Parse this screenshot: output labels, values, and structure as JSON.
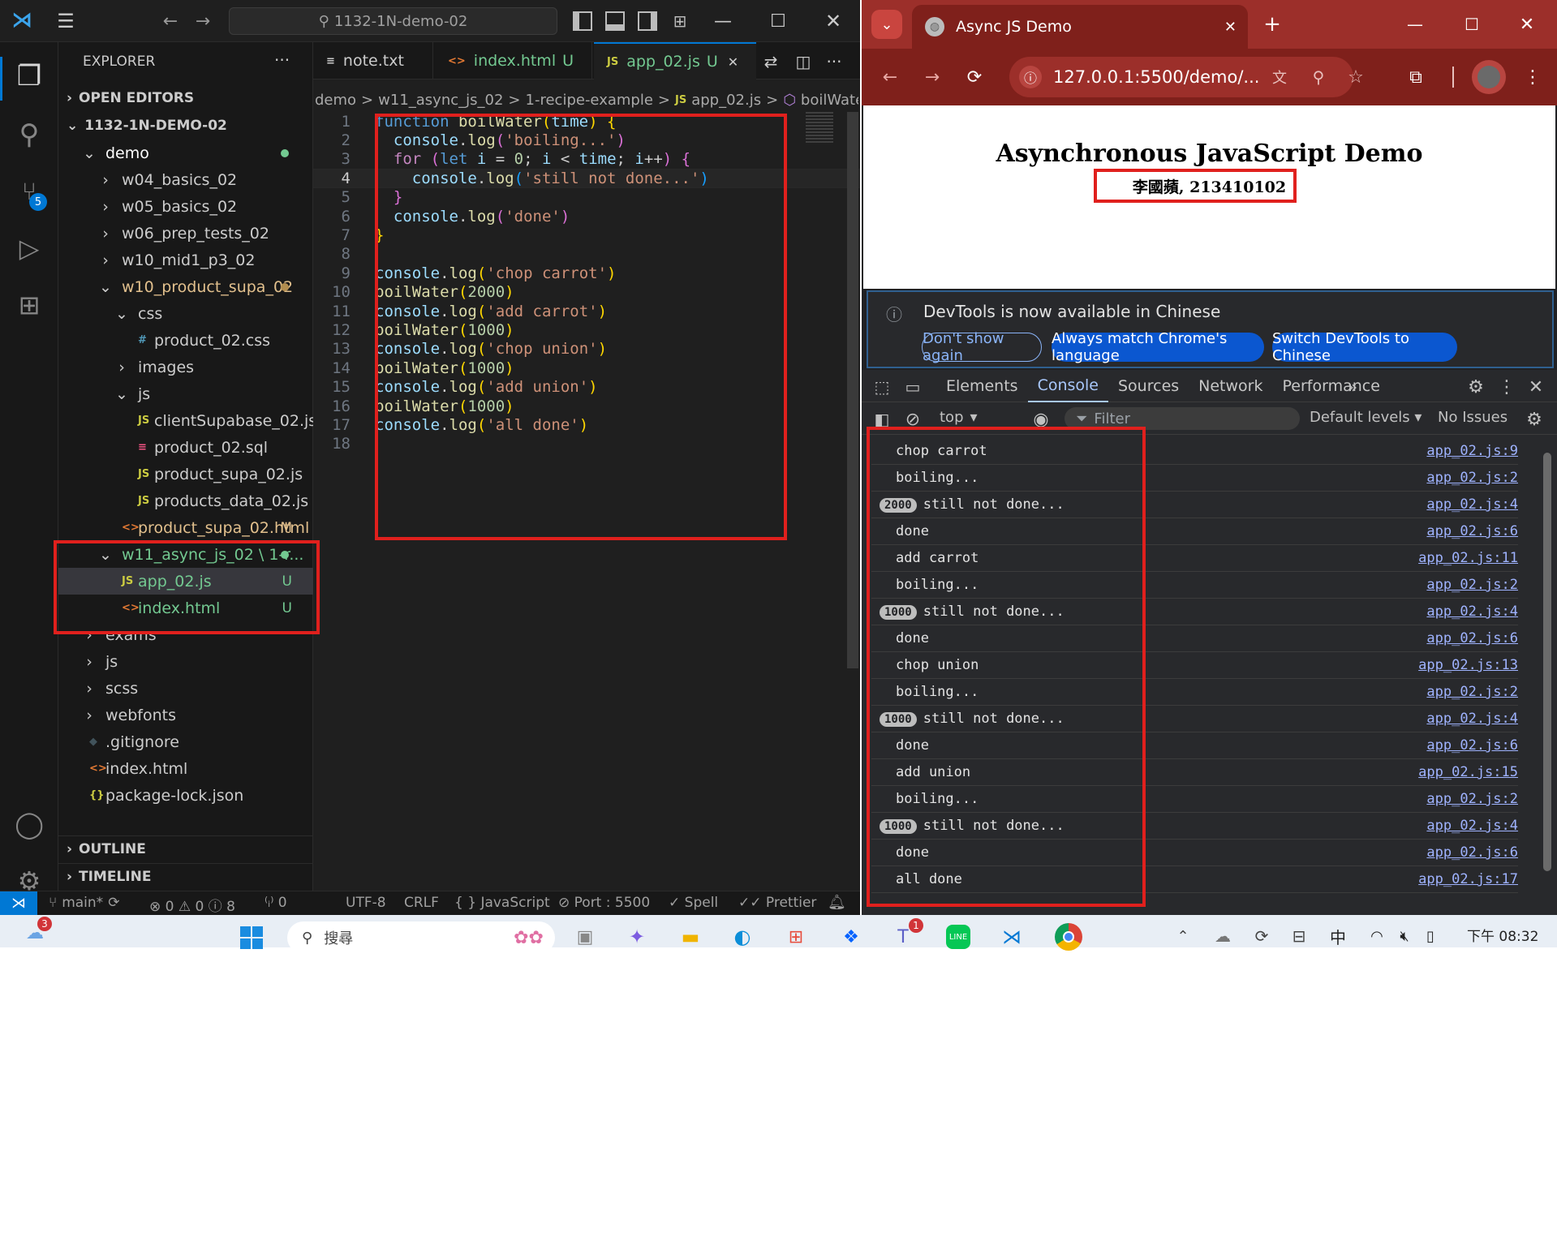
{
  "vscode": {
    "search_text": "1132-1N-demo-02",
    "explorer_title": "EXPLORER",
    "open_editors": "OPEN EDITORS",
    "project": "1132-1N-DEMO-02",
    "tree": [
      {
        "label": "demo",
        "indent": 0,
        "chev": "v",
        "color": "#ffffff",
        "dot": "#73c991"
      },
      {
        "label": "w04_basics_02",
        "indent": 1,
        "chev": ">",
        "color": "#cccccc"
      },
      {
        "label": "w05_basics_02",
        "indent": 1,
        "chev": ">",
        "color": "#cccccc"
      },
      {
        "label": "w06_prep_tests_02",
        "indent": 1,
        "chev": ">",
        "color": "#cccccc"
      },
      {
        "label": "w10_mid1_p3_02",
        "indent": 1,
        "chev": ">",
        "color": "#cccccc"
      },
      {
        "label": "w10_product_supa_02",
        "indent": 1,
        "chev": "v",
        "color": "#e2c08d",
        "dot": "#b28d4f"
      },
      {
        "label": "css",
        "indent": 2,
        "chev": "v",
        "color": "#cccccc"
      },
      {
        "label": "product_02.css",
        "indent": 3,
        "icon": "#",
        "iconcolor": "#519aba",
        "color": "#cccccc"
      },
      {
        "label": "images",
        "indent": 2,
        "chev": ">",
        "color": "#cccccc"
      },
      {
        "label": "js",
        "indent": 2,
        "chev": "v",
        "color": "#cccccc"
      },
      {
        "label": "clientSupabase_02.js",
        "indent": 3,
        "icon": "JS",
        "iconcolor": "#cbcb41",
        "color": "#cccccc"
      },
      {
        "label": "product_02.sql",
        "indent": 3,
        "icon": "≡",
        "iconcolor": "#f55385",
        "color": "#cccccc"
      },
      {
        "label": "product_supa_02.js",
        "indent": 3,
        "icon": "JS",
        "iconcolor": "#cbcb41",
        "color": "#cccccc"
      },
      {
        "label": "products_data_02.js",
        "indent": 3,
        "icon": "JS",
        "iconcolor": "#cbcb41",
        "color": "#cccccc"
      },
      {
        "label": "product_supa_02.html",
        "indent": 2,
        "icon": "<>",
        "iconcolor": "#e37933",
        "color": "#e2c08d",
        "badge": "M"
      },
      {
        "label": "w11_async_js_02 \\ 1-r...",
        "indent": 1,
        "chev": "v",
        "color": "#73c991",
        "dot": "#73c991"
      },
      {
        "label": "app_02.js",
        "indent": 2,
        "icon": "JS",
        "iconcolor": "#cbcb41",
        "color": "#73c991",
        "badge": "U",
        "selected": true
      },
      {
        "label": "index.html",
        "indent": 2,
        "icon": "<>",
        "iconcolor": "#e37933",
        "color": "#73c991",
        "badge": "U"
      },
      {
        "label": "exams",
        "indent": 0,
        "chev": ">",
        "color": "#cccccc"
      },
      {
        "label": "js",
        "indent": 0,
        "chev": ">",
        "color": "#cccccc"
      },
      {
        "label": "scss",
        "indent": 0,
        "chev": ">",
        "color": "#cccccc"
      },
      {
        "label": "webfonts",
        "indent": 0,
        "chev": ">",
        "color": "#cccccc"
      },
      {
        "label": ".gitignore",
        "indent": 0,
        "icon": "◆",
        "iconcolor": "#41535b",
        "color": "#cccccc"
      },
      {
        "label": "index.html",
        "indent": 0,
        "icon": "<>",
        "iconcolor": "#e37933",
        "color": "#cccccc"
      },
      {
        "label": "package-lock.json",
        "indent": 0,
        "icon": "{}",
        "iconcolor": "#cbcb41",
        "color": "#cccccc"
      }
    ],
    "outline": "OUTLINE",
    "timeline": "TIMELINE",
    "tabs": [
      {
        "label": "note.txt",
        "icon": "≡",
        "iconcolor": "#cccccc",
        "color": "#cccccc"
      },
      {
        "label": "index.html",
        "suffix": "U",
        "icon": "<>",
        "iconcolor": "#e37933",
        "color": "#73c991"
      },
      {
        "label": "app_02.js",
        "suffix": "U",
        "icon": "JS",
        "iconcolor": "#cbcb41",
        "color": "#73c991",
        "active": true
      }
    ],
    "breadcrumb": [
      "demo",
      ">",
      "w11_async_js_02",
      ">",
      "1-recipe-example",
      ">",
      "JS",
      "app_02.js",
      ">",
      "⬡",
      "boilWater"
    ],
    "code": [
      [
        [
          "function ",
          "kw"
        ],
        [
          "boilWater",
          "fn"
        ],
        [
          "(",
          "br1"
        ],
        [
          "time",
          "var"
        ],
        [
          ")",
          "br1"
        ],
        [
          " {",
          "br1"
        ]
      ],
      [
        [
          "  console",
          "var"
        ],
        [
          ".",
          "pl"
        ],
        [
          "log",
          "fn"
        ],
        [
          "(",
          "br2"
        ],
        [
          "'boiling...'",
          "str"
        ],
        [
          ")",
          "br2"
        ]
      ],
      [
        [
          "  for ",
          "ctl"
        ],
        [
          "(",
          "br2"
        ],
        [
          "let ",
          "kw"
        ],
        [
          "i",
          "var"
        ],
        [
          " = ",
          "pl"
        ],
        [
          "0",
          "num"
        ],
        [
          "; ",
          "pl"
        ],
        [
          "i",
          "var"
        ],
        [
          " < ",
          "pl"
        ],
        [
          "time",
          "var"
        ],
        [
          "; ",
          "pl"
        ],
        [
          "i",
          "var"
        ],
        [
          "++",
          "pl"
        ],
        [
          ")",
          "br2"
        ],
        [
          " {",
          "br2"
        ]
      ],
      [
        [
          "    console",
          "var"
        ],
        [
          ".",
          "pl"
        ],
        [
          "log",
          "fn"
        ],
        [
          "(",
          "br3"
        ],
        [
          "'still not done...'",
          "str"
        ],
        [
          ")",
          "br3"
        ]
      ],
      [
        [
          "  }",
          "br2"
        ]
      ],
      [
        [
          "  console",
          "var"
        ],
        [
          ".",
          "pl"
        ],
        [
          "log",
          "fn"
        ],
        [
          "(",
          "br2"
        ],
        [
          "'done'",
          "str"
        ],
        [
          ")",
          "br2"
        ]
      ],
      [
        [
          "}",
          "br1"
        ]
      ],
      [],
      [
        [
          "console",
          "var"
        ],
        [
          ".",
          "pl"
        ],
        [
          "log",
          "fn"
        ],
        [
          "(",
          "br1"
        ],
        [
          "'chop carrot'",
          "str"
        ],
        [
          ")",
          "br1"
        ]
      ],
      [
        [
          "boilWater",
          "fn"
        ],
        [
          "(",
          "br1"
        ],
        [
          "2000",
          "num"
        ],
        [
          ")",
          "br1"
        ]
      ],
      [
        [
          "console",
          "var"
        ],
        [
          ".",
          "pl"
        ],
        [
          "log",
          "fn"
        ],
        [
          "(",
          "br1"
        ],
        [
          "'add carrot'",
          "str"
        ],
        [
          ")",
          "br1"
        ]
      ],
      [
        [
          "boilWater",
          "fn"
        ],
        [
          "(",
          "br1"
        ],
        [
          "1000",
          "num"
        ],
        [
          ")",
          "br1"
        ]
      ],
      [
        [
          "console",
          "var"
        ],
        [
          ".",
          "pl"
        ],
        [
          "log",
          "fn"
        ],
        [
          "(",
          "br1"
        ],
        [
          "'chop union'",
          "str"
        ],
        [
          ")",
          "br1"
        ]
      ],
      [
        [
          "boilWater",
          "fn"
        ],
        [
          "(",
          "br1"
        ],
        [
          "1000",
          "num"
        ],
        [
          ")",
          "br1"
        ]
      ],
      [
        [
          "console",
          "var"
        ],
        [
          ".",
          "pl"
        ],
        [
          "log",
          "fn"
        ],
        [
          "(",
          "br1"
        ],
        [
          "'add union'",
          "str"
        ],
        [
          ")",
          "br1"
        ]
      ],
      [
        [
          "boilWater",
          "fn"
        ],
        [
          "(",
          "br1"
        ],
        [
          "1000",
          "num"
        ],
        [
          ")",
          "br1"
        ]
      ],
      [
        [
          "console",
          "var"
        ],
        [
          ".",
          "pl"
        ],
        [
          "log",
          "fn"
        ],
        [
          "(",
          "br1"
        ],
        [
          "'all done'",
          "str"
        ],
        [
          ")",
          "br1"
        ]
      ],
      []
    ],
    "status": {
      "branch": "main*",
      "errors": "⊗ 0 ⚠ 0 ⓘ 8",
      "ports": "⁽ᵢ⁾ 0",
      "encoding": "UTF-8",
      "eol": "CRLF",
      "language": "{ } JavaScript",
      "port": "⊘ Port : 5500",
      "spell": "✓ Spell",
      "prettier": "✓✓ Prettier"
    },
    "source_control_badge": "5"
  },
  "chrome": {
    "tab_title": "Async JS Demo",
    "url": "127.0.0.1:5500/demo/...",
    "page_heading": "Asynchronous JavaScript Demo",
    "page_subheading": "李國蘋, 213410102",
    "banner_text": "DevTools is now available in Chinese",
    "banner_buttons": [
      "Don't show again",
      "Always match Chrome's language",
      "Switch DevTools to Chinese"
    ],
    "devtools_tabs": [
      "Elements",
      "Console",
      "Sources",
      "Network",
      "Performance"
    ],
    "active_devtools_tab": "Console",
    "context": "top",
    "filter_placeholder": "Filter",
    "levels": "Default levels",
    "issues": "No Issues",
    "console": [
      {
        "msg": "chop carrot",
        "src": "app_02.js:9"
      },
      {
        "msg": "boiling...",
        "src": "app_02.js:2"
      },
      {
        "msg": "still not done...",
        "src": "app_02.js:4",
        "count": "2000"
      },
      {
        "msg": "done",
        "src": "app_02.js:6"
      },
      {
        "msg": "add carrot",
        "src": "app_02.js:11"
      },
      {
        "msg": "boiling...",
        "src": "app_02.js:2"
      },
      {
        "msg": "still not done...",
        "src": "app_02.js:4",
        "count": "1000"
      },
      {
        "msg": "done",
        "src": "app_02.js:6"
      },
      {
        "msg": "chop union",
        "src": "app_02.js:13"
      },
      {
        "msg": "boiling...",
        "src": "app_02.js:2"
      },
      {
        "msg": "still not done...",
        "src": "app_02.js:4",
        "count": "1000"
      },
      {
        "msg": "done",
        "src": "app_02.js:6"
      },
      {
        "msg": "add union",
        "src": "app_02.js:15"
      },
      {
        "msg": "boiling...",
        "src": "app_02.js:2"
      },
      {
        "msg": "still not done...",
        "src": "app_02.js:4",
        "count": "1000"
      },
      {
        "msg": "done",
        "src": "app_02.js:6"
      },
      {
        "msg": "all done",
        "src": "app_02.js:17"
      }
    ]
  },
  "taskbar": {
    "weather_badge": "3",
    "search_text": "搜尋",
    "teams_badge": "1",
    "time": "下午 08:32",
    "ime": "中"
  }
}
